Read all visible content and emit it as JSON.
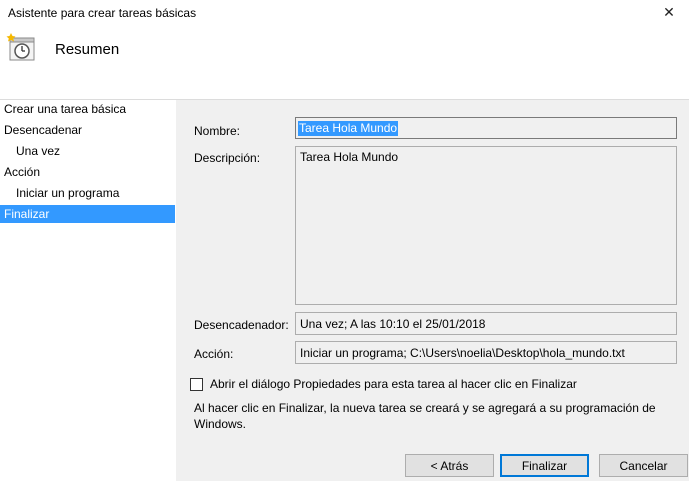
{
  "window": {
    "title": "Asistente para crear tareas básicas"
  },
  "header": {
    "title": "Resumen",
    "icon": "clock-task-icon"
  },
  "sidebar": {
    "items": [
      {
        "label": "Crear una tarea básica"
      },
      {
        "label": "Desencadenar"
      },
      {
        "label": "Una vez"
      },
      {
        "label": "Acción"
      },
      {
        "label": "Iniciar un programa"
      },
      {
        "label": "Finalizar",
        "selected": true
      }
    ]
  },
  "form": {
    "name_label": "Nombre:",
    "name_value": "Tarea Hola Mundo",
    "description_label": "Descripción:",
    "description_value": "Tarea Hola Mundo",
    "trigger_label": "Desencadenador:",
    "trigger_value": "Una vez; A las 10:10 el 25/01/2018",
    "action_label": "Acción:",
    "action_value": "Iniciar un programa; C:\\Users\\noelia\\Desktop\\hola_mundo.txt"
  },
  "options": {
    "open_properties_label": "Abrir el diálogo Propiedades para esta tarea al hacer clic en Finalizar",
    "open_properties_checked": false,
    "note": "Al hacer clic en Finalizar, la nueva tarea se creará y se agregará a su programación de Windows."
  },
  "buttons": {
    "back": "< Atrás",
    "finish": "Finalizar",
    "cancel": "Cancelar"
  },
  "colors": {
    "selection": "#3399ff",
    "default_button_border": "#0078d7"
  }
}
